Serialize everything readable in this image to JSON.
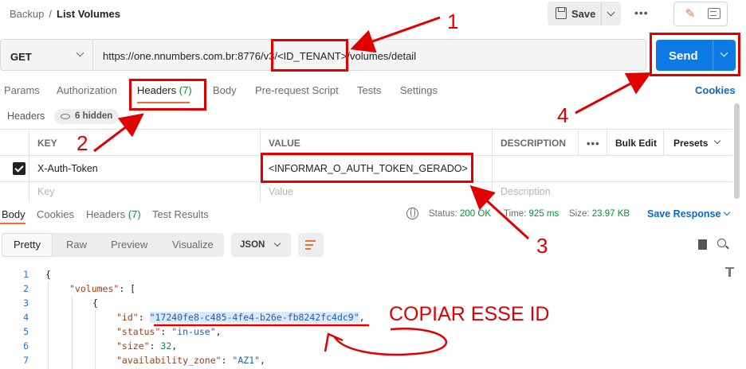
{
  "breadcrumb": {
    "parent": "Backup",
    "separator": "/",
    "current": "List Volumes"
  },
  "toolbar": {
    "save_label": "Save",
    "more_label": "•••"
  },
  "request": {
    "method": "GET",
    "url": "https://one.nnumbers.com.br:8776/v3/<ID_TENANT>/volumes/detail",
    "send_label": "Send"
  },
  "request_tabs": [
    {
      "label": "Params"
    },
    {
      "label": "Authorization"
    },
    {
      "label": "Headers",
      "count": "(7)"
    },
    {
      "label": "Body"
    },
    {
      "label": "Pre-request Script"
    },
    {
      "label": "Tests"
    },
    {
      "label": "Settings"
    }
  ],
  "cookies_label": "Cookies",
  "headers_section": {
    "label": "Headers",
    "hidden_chip": "6 hidden"
  },
  "headers_table": {
    "columns": {
      "key": "KEY",
      "value": "VALUE",
      "description": "DESCRIPTION",
      "bulk_edit": "Bulk Edit",
      "presets": "Presets",
      "more": "•••"
    },
    "rows": [
      {
        "key": "X-Auth-Token",
        "value": "<INFORMAR_O_AUTH_TOKEN_GERADO>",
        "description": "",
        "checked": true
      }
    ],
    "placeholders": {
      "key": "Key",
      "value": "Value",
      "description": "Description"
    }
  },
  "response_tabs": [
    {
      "label": "Body"
    },
    {
      "label": "Cookies"
    },
    {
      "label": "Headers",
      "count": "(7)"
    },
    {
      "label": "Test Results"
    }
  ],
  "response_status": {
    "status_label": "Status:",
    "status_value": "200 OK",
    "time_label": "Time:",
    "time_value": "925 ms",
    "size_label": "Size:",
    "size_value": "23.97 KB",
    "save_response": "Save Response"
  },
  "view_modes": [
    "Pretty",
    "Raw",
    "Preview",
    "Visualize"
  ],
  "format": "JSON",
  "code_lines": [
    {
      "n": "1"
    },
    {
      "n": "2"
    },
    {
      "n": "3"
    },
    {
      "n": "4"
    },
    {
      "n": "5"
    },
    {
      "n": "6"
    },
    {
      "n": "7"
    }
  ],
  "json": {
    "volumes_key": "\"volumes\"",
    "id_key": "\"id\"",
    "id_value": "\"17240fe8-c485-4fe4-b26e-fb8242fc4dc9\"",
    "status_key": "\"status\"",
    "status_value": "\"in-use\"",
    "size_key": "\"size\"",
    "size_value": "32",
    "az_key": "\"availability_zone\"",
    "az_value": "\"AZ1\""
  },
  "annotations": {
    "n1": "1",
    "n2": "2",
    "n3": "3",
    "n4": "4",
    "copy_note": "COPIAR ESSE ID"
  },
  "colors": {
    "accent": "#f26b3a",
    "send": "#0d79e5",
    "annotation": "#e00000",
    "link": "#0d66d0",
    "ok": "#0e8a3a"
  }
}
